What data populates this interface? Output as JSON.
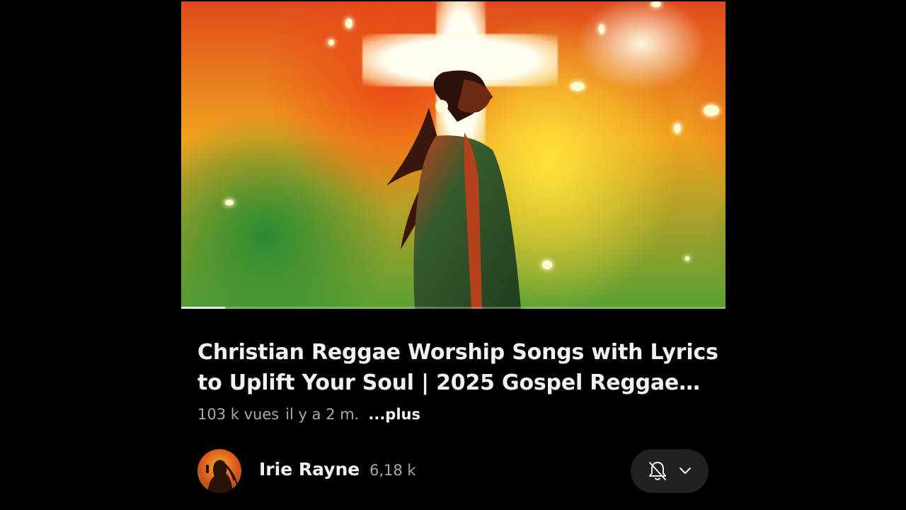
{
  "video": {
    "title": "Christian Reggae Worship Songs with Lyrics to Uplift Your Soul | 2025 Gospel Reggae Music",
    "progress": 0.08
  },
  "meta": {
    "views": "103 k vues",
    "age": "il y a 2 m.",
    "more_label": "...plus"
  },
  "channel": {
    "name": "Irie Rayne",
    "subscribers": "6,18 k"
  },
  "icons": {
    "notification": "bell-off-icon",
    "dropdown": "chevron-down-icon"
  },
  "colors": {
    "background": "#000000",
    "text_primary": "#f1f1f1",
    "text_secondary": "#aaaaaa",
    "button_bg": "#212121"
  }
}
